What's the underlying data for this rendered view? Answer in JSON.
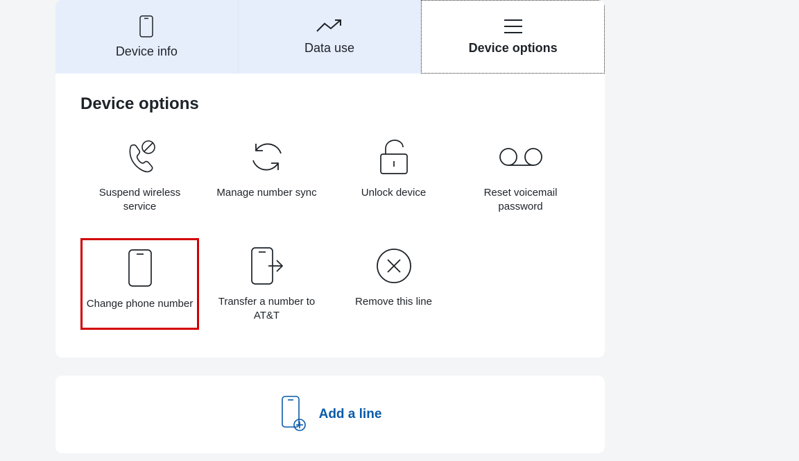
{
  "tabs": {
    "device_info": "Device info",
    "data_use": "Data use",
    "device_options": "Device options"
  },
  "panel": {
    "title": "Device options",
    "options": {
      "suspend": "Suspend wireless service",
      "manage_sync": "Manage number sync",
      "unlock": "Unlock device",
      "reset_vm": "Reset voicemail password",
      "change_number": "Change phone number",
      "transfer": "Transfer a number to AT&T",
      "remove": "Remove this line"
    }
  },
  "add_line": {
    "label": "Add a line"
  }
}
